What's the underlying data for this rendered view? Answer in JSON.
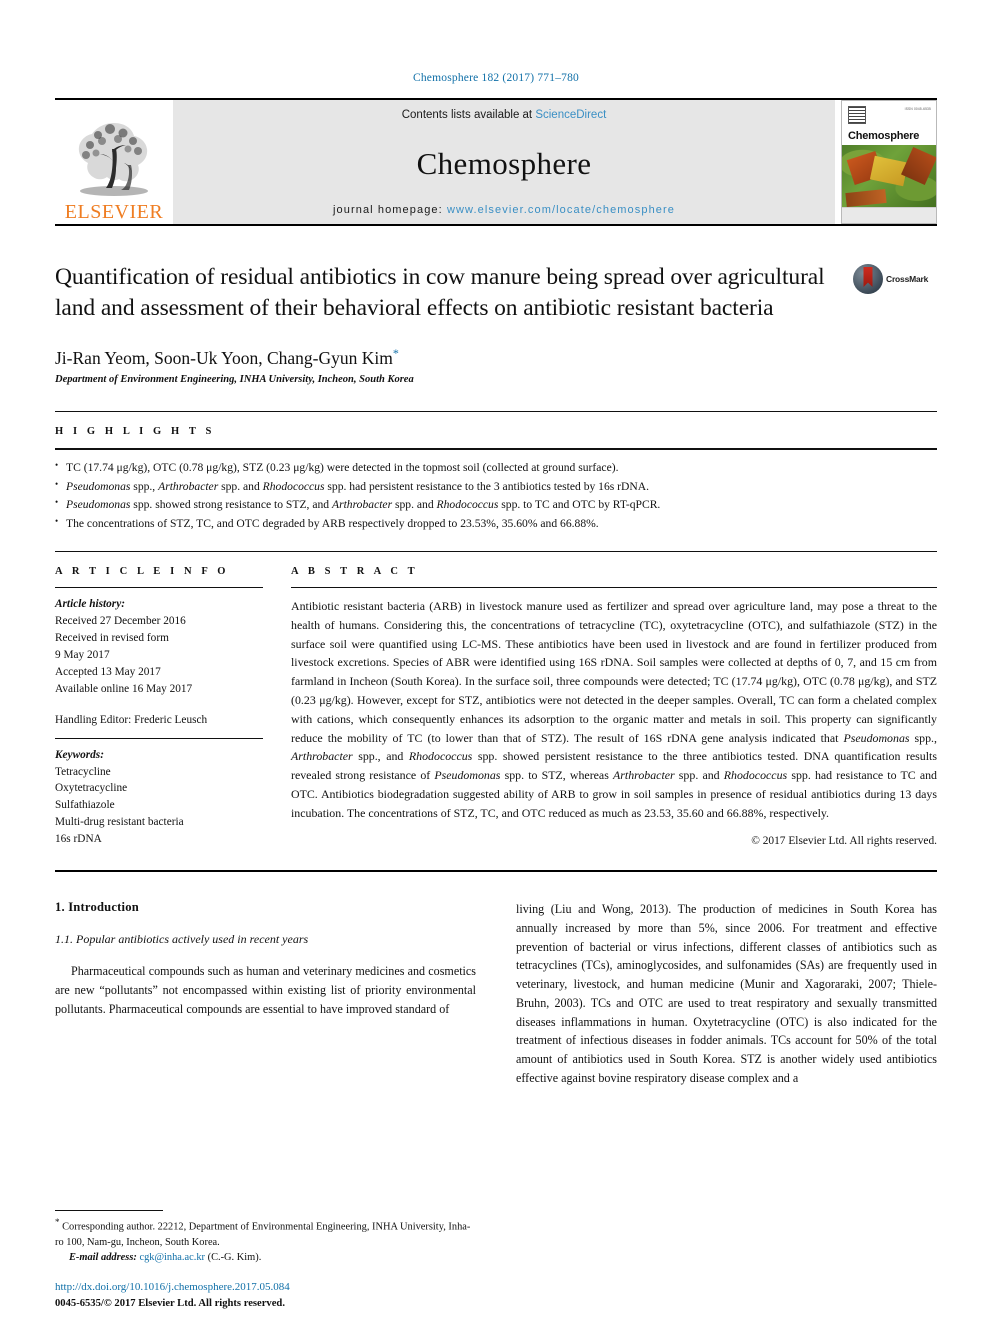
{
  "running_head": "Chemosphere 182 (2017) 771–780",
  "masthead": {
    "publisher": "ELSEVIER",
    "publisher_logo": "elsevier-tree-logo",
    "contents_prefix": "Contents lists available at ",
    "contents_link": "ScienceDirect",
    "journal_title": "Chemosphere",
    "homepage_prefix": "journal homepage: ",
    "homepage_url": "www.elsevier.com/locate/chemosphere",
    "cover": {
      "journal_name": "Chemosphere",
      "issn_text": "ISSN 0045-6535"
    }
  },
  "article": {
    "title": "Quantification of residual antibiotics in cow manure being spread over agricultural land and assessment of their behavioral effects on antibiotic resistant bacteria",
    "crossmark_label": "CrossMark",
    "authors": "Ji-Ran Yeom, Soon-Uk Yoon, Chang-Gyun Kim",
    "corresponding_marker": "*",
    "affiliation": "Department of Environment Engineering, INHA University, Incheon, South Korea"
  },
  "highlights": {
    "heading": "H I G H L I G H T S",
    "items": [
      "TC (17.74 μg/kg), OTC (0.78 μg/kg), STZ (0.23 μg/kg) were detected in the topmost soil (collected at ground surface).",
      "Pseudomonas spp., Arthrobacter spp. and Rhodococcus spp. had persistent resistance to the 3 antibiotics tested by 16s rDNA.",
      "Pseudomonas spp. showed strong resistance to STZ, and Arthrobacter spp. and Rhodococcus spp. to TC and OTC by RT-qPCR.",
      "The concentrations of STZ, TC, and OTC degraded by ARB respectively dropped to 23.53%, 35.60% and 66.88%."
    ]
  },
  "article_info": {
    "heading": "A R T I C L E   I N F O",
    "history_label": "Article history:",
    "history_lines": [
      "Received 27 December 2016",
      "Received in revised form",
      "9 May 2017",
      "Accepted 13 May 2017",
      "Available online 16 May 2017"
    ],
    "handling_editor": "Handling Editor: Frederic Leusch",
    "keywords_label": "Keywords:",
    "keywords": [
      "Tetracycline",
      "Oxytetracycline",
      "Sulfathiazole",
      "Multi-drug resistant bacteria",
      "16s rDNA"
    ]
  },
  "abstract": {
    "heading": "A B S T R A C T",
    "text": "Antibiotic resistant bacteria (ARB) in livestock manure used as fertilizer and spread over agriculture land, may pose a threat to the health of humans. Considering this, the concentrations of tetracycline (TC), oxytetracycline (OTC), and sulfathiazole (STZ) in the surface soil were quantified using LC-MS. These antibiotics have been used in livestock and are found in fertilizer produced from livestock excretions. Species of ABR were identified using 16S rDNA. Soil samples were collected at depths of 0, 7, and 15 cm from farmland in Incheon (South Korea). In the surface soil, three compounds were detected; TC (17.74 μg/kg), OTC (0.78 μg/kg), and STZ (0.23 μg/kg). However, except for STZ, antibiotics were not detected in the deeper samples. Overall, TC can form a chelated complex with cations, which consequently enhances its adsorption to the organic matter and metals in soil. This property can significantly reduce the mobility of TC (to lower than that of STZ). The result of 16S rDNA gene analysis indicated that Pseudomonas spp., Arthrobacter spp., and Rhodococcus spp. showed persistent resistance to the three antibiotics tested. DNA quantification results revealed strong resistance of Pseudomonas spp. to STZ, whereas Arthrobacter spp. and Rhodococcus spp. had resistance to TC and OTC. Antibiotics biodegradation suggested ability of ARB to grow in soil samples in presence of residual antibiotics during 13 days incubation. The concentrations of STZ, TC, and OTC reduced as much as 23.53, 35.60 and 66.88%, respectively.",
    "copyright": "© 2017 Elsevier Ltd. All rights reserved."
  },
  "body": {
    "section_number_title": "1. Introduction",
    "subsection_title": "1.1. Popular antibiotics actively used in recent years",
    "left_paragraph": "Pharmaceutical compounds such as human and veterinary medicines and cosmetics are new “pollutants” not encompassed within existing list of priority environmental pollutants. Pharmaceutical compounds are essential to have improved standard of",
    "right_paragraph_part1": "living (",
    "right_cite1": "Liu and Wong, 2013",
    "right_paragraph_part2": "). The production of medicines in South Korea has annually increased by more than 5%, since 2006. For treatment and effective prevention of bacterial or virus infections, different classes of antibiotics such as tetracyclines (TCs), aminoglycosides, and sulfonamides (SAs) are frequently used in veterinary, livestock, and human medicine (",
    "right_cite2": "Munir and Xagoraraki, 2007; Thiele-Bruhn, 2003",
    "right_paragraph_part3": "). TCs and OTC are used to treat respiratory and sexually transmitted diseases inflammations in human. Oxytetracycline (OTC) is also indicated for the treatment of infectious diseases in fodder animals. TCs account for 50% of the total amount of antibiotics used in South Korea. STZ is another widely used antibiotics effective against bovine respiratory disease complex and a"
  },
  "footnote": {
    "marker": "*",
    "corresponding_text": "Corresponding author. 22212, Department of Environmental Engineering, INHA University, Inha-ro 100, Nam-gu, Incheon, South Korea.",
    "email_label": "E-mail address:",
    "email": "cgk@inha.ac.kr",
    "email_owner": "(C.-G. Kim)."
  },
  "footer": {
    "doi": "http://dx.doi.org/10.1016/j.chemosphere.2017.05.084",
    "issn_copyright": "0045-6535/© 2017 Elsevier Ltd. All rights reserved."
  },
  "colors": {
    "link": "#1170a8",
    "elsevier_orange": "#ef7d22",
    "band_gray": "#e6e6e6"
  }
}
